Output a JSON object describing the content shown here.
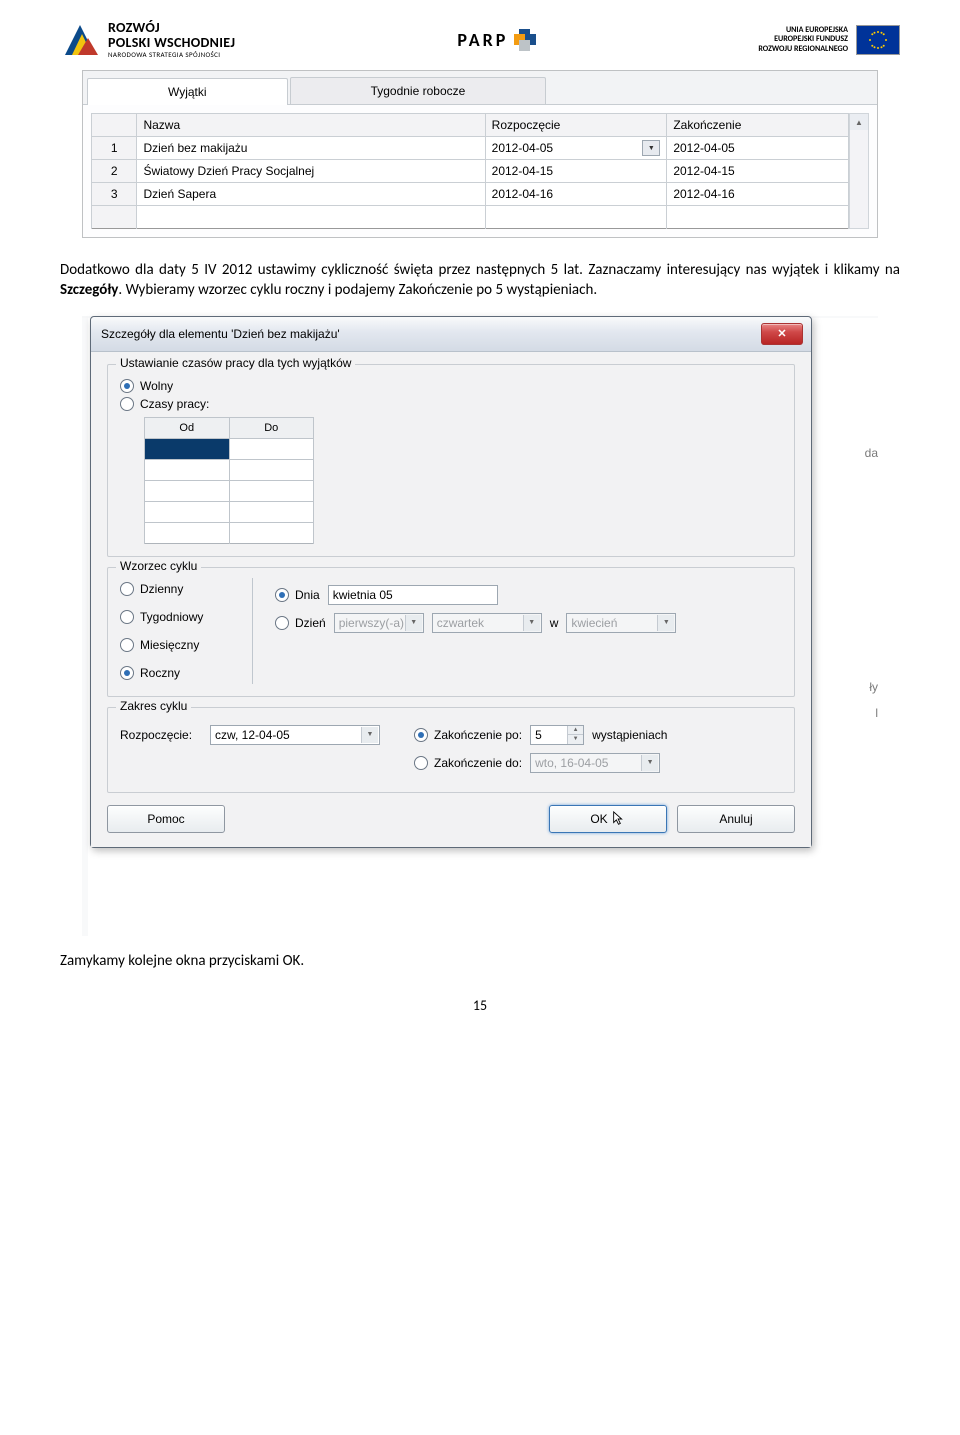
{
  "header": {
    "left_line1": "ROZWÓJ",
    "left_line2": "POLSKI WSCHODNIEJ",
    "left_line3": "NARODOWA STRATEGIA SPÓJNOŚCI",
    "center": "PARP",
    "right_line1": "UNIA EUROPEJSKA",
    "right_line2": "EUROPEJSKI FUNDUSZ",
    "right_line3": "ROZWOJU REGIONALNEGO"
  },
  "ss1": {
    "tabs": {
      "t1": "Wyjątki",
      "t2": "Tygodnie robocze"
    },
    "columns": {
      "name": "Nazwa",
      "start": "Rozpoczęcie",
      "end": "Zakończenie"
    },
    "rows": [
      {
        "idx": "1",
        "name": "Dzień bez makijażu",
        "start": "2012-04-05",
        "end": "2012-04-05"
      },
      {
        "idx": "2",
        "name": "Światowy Dzień Pracy Socjalnej",
        "start": "2012-04-15",
        "end": "2012-04-15"
      },
      {
        "idx": "3",
        "name": "Dzień Sapera",
        "start": "2012-04-16",
        "end": "2012-04-16"
      }
    ]
  },
  "para1_a": "Dodatkowo dla daty 5 IV 2012 ustawimy cykliczność święta przez następnych 5 lat. Zaznaczamy interesujący nas wyjątek i klikamy na ",
  "para1_b": "Szczegóły",
  "para1_c": ". Wybieramy wzorzec cyklu roczny i podajemy Zakończenie po 5 wystąpieniach.",
  "ss2": {
    "title": "Szczegóły dla elementu 'Dzień bez makijażu'",
    "group1_legend": "Ustawianie czasów pracy dla tych wyjątków",
    "opt_wolny": "Wolny",
    "opt_czasy": "Czasy pracy:",
    "times_cols": {
      "from": "Od",
      "to": "Do"
    },
    "group2_legend": "Wzorzec cyklu",
    "recur_opts": {
      "daily": "Dzienny",
      "weekly": "Tygodniowy",
      "monthly": "Miesięczny",
      "yearly": "Roczny"
    },
    "dnia": "Dnia",
    "dnia_val": "kwietnia 05",
    "dzien": "Dzień",
    "dzien_ord": "pierwszy(-a)",
    "dzien_dow": "czwartek",
    "w_label": "w",
    "dzien_month": "kwiecień",
    "group3_legend": "Zakres cyklu",
    "rozp_label": "Rozpoczęcie:",
    "rozp_val": "czw, 12-04-05",
    "zak_po_label": "Zakończenie po:",
    "zak_po_val": "5",
    "zak_po_suffix": "wystąpieniach",
    "zak_do_label": "Zakończenie do:",
    "zak_do_val": "wto, 16-04-05",
    "buttons": {
      "help": "Pomoc",
      "ok": "OK",
      "cancel": "Anuluj"
    },
    "edge_da": "da",
    "edge_ly": "ły",
    "edge_l": "l"
  },
  "para2": "Zamykamy kolejne okna przyciskami OK.",
  "page_number": "15"
}
